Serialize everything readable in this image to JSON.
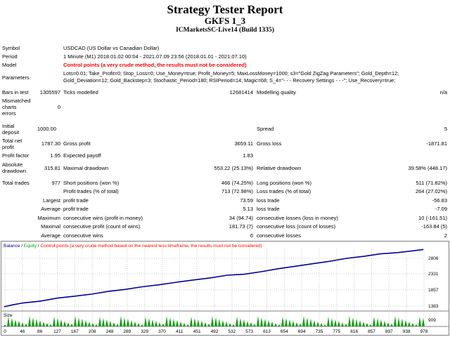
{
  "header": {
    "title": "Strategy Tester Report",
    "expert": "GKFS 1_3",
    "server": "ICMarketsSC-Live14 (Build 1335)"
  },
  "info": {
    "symbol_label": "Symbol",
    "symbol_value": "USDCAD (US Dollar vs Canadian Dollar)",
    "period_label": "Period",
    "period_value": "1 Minute (M1) 2018.01.02 00:04 - 2021.07.09 23:56 (2018.01.01 - 2021.07.10)",
    "model_label": "Model",
    "model_value": "Control points (a very crude method, the results must not be considered)",
    "params_label": "Parameters",
    "params_line1": "Lots=0.01; Take_Profit=0; Stop_Loss=0; Use_Money=true; Profit_Money=5; MaxLossMoney=1000; s3=\"Gold ZigZag Parameters\"; Gold_Depth=12;",
    "params_line2": "Gold_Deviation=12; Gold_Backstep=3; Stochastic_Period=180; RSIPeriod=14; Magic=68; S_4=\"- - - Recovery Settings - - -\"; Use_Recovery=true;"
  },
  "stats": {
    "bars_label": "Bars in test",
    "bars_value": "1305597",
    "ticks_label": "Ticks modelled",
    "ticks_value": "12681414",
    "quality_label": "Modelling quality",
    "quality_value": "n/a",
    "mismatch_label1": "Mismatched",
    "mismatch_label2": "charts",
    "mismatch_label3": "errors",
    "mismatch_value": "0",
    "deposit_label1": "Initial",
    "deposit_label2": "deposit",
    "deposit_value": "1000.00",
    "spread_label": "Spread",
    "spread_value": "5",
    "netprofit_label1": "Total net",
    "netprofit_label2": "profit",
    "netprofit_value": "1787.30",
    "grossprofit_label": "Gross profit",
    "grossprofit_value": "3659.11",
    "grossloss_label": "Gross loss",
    "grossloss_value": "-1871.81",
    "pf_label": "Profit factor",
    "pf_value": "1.95",
    "payoff_label": "Expected payoff",
    "payoff_value": "1.83",
    "absdd_label1": "Absolute",
    "absdd_label2": "drawdown",
    "absdd_value": "315.81",
    "maxdd_label": "Maximal drawdown",
    "maxdd_value": "553.22 (25.13%)",
    "reldd_label": "Relative drawdown",
    "reldd_value": "39.58% (448.17)",
    "trades_label": "Total trades",
    "trades_value": "977",
    "short_label": "Short positions (won %)",
    "short_value": "466 (74.25%)",
    "long_label": "Long positions (won %)",
    "long_value": "511 (71.82%)",
    "profittrades_label": "Profit trades (% of total)",
    "profittrades_value": "713 (72.98%)",
    "losstrades_label": "Loss trades (% of total)",
    "losstrades_value": "264 (27.02%)",
    "largest_label": "Largest",
    "avg_label": "Average",
    "maximum_label": "Maximum",
    "maximal_label": "Maximal",
    "average2_label": "Average",
    "lp_label": "profit trade",
    "lp_value": "73.59",
    "ll_label": "loss trade",
    "ll_value": "-56.83",
    "ap_label": "profit trade",
    "ap_value": "5.13",
    "al_label": "loss trade",
    "al_value": "-7.09",
    "mcw_label": "consecutive wins (profit in money)",
    "mcw_value": "34 (94.74)",
    "mcl_label": "consecutive losses (loss in money)",
    "mcl_value": "10 (-161.51)",
    "mcp_label": "consecutive profit (count of wins)",
    "mcp_value": "181.73 (7)",
    "mclc_label": "consecutive loss (count of losses)",
    "mclc_value": "-163.84 (5)",
    "acw_label": "consecutive wins",
    "acw_value": "6",
    "acl_label": "consecutive losses",
    "acl_value": "2"
  },
  "chart_data": {
    "type": "line",
    "legend": {
      "balance": "Balance",
      "sep1": " / ",
      "equity": "Equity",
      "sep2": " / ",
      "control": "Control points (a very crude method based on the nearest less timeframe, the results must not be considered)"
    },
    "y_ticks": [
      "2806",
      "2331",
      "1857",
      "1383",
      "909"
    ],
    "x_ticks": [
      "0",
      "46",
      "86",
      "127",
      "167",
      "208",
      "248",
      "289",
      "329",
      "370",
      "411",
      "451",
      "492",
      "532",
      "573",
      "613",
      "654",
      "694",
      "735",
      "775",
      "816",
      "857",
      "897",
      "938",
      "978"
    ],
    "ylim": [
      909,
      2806
    ],
    "xlim": [
      0,
      978
    ],
    "size_label": "Size",
    "series": [
      {
        "name": "Balance",
        "color": "#0000a0",
        "x": [
          0,
          20,
          46,
          86,
          127,
          167,
          208,
          248,
          289,
          329,
          370,
          411,
          451,
          492,
          532,
          573,
          613,
          654,
          694,
          735,
          775,
          816,
          857,
          897,
          938,
          978,
          1000
        ],
        "values": [
          1000,
          1060,
          1120,
          1175,
          1270,
          1330,
          1395,
          1480,
          1545,
          1625,
          1690,
          1770,
          1840,
          1905,
          1990,
          2020,
          2100,
          2195,
          2270,
          2350,
          2425,
          2520,
          2580,
          2660,
          2700,
          2760,
          2800
        ]
      }
    ],
    "colors": {
      "balance": "#0000a0",
      "equity": "#00a000",
      "control": "#ff0000",
      "grid": "#c8c8c8",
      "size": "#00a000"
    }
  }
}
